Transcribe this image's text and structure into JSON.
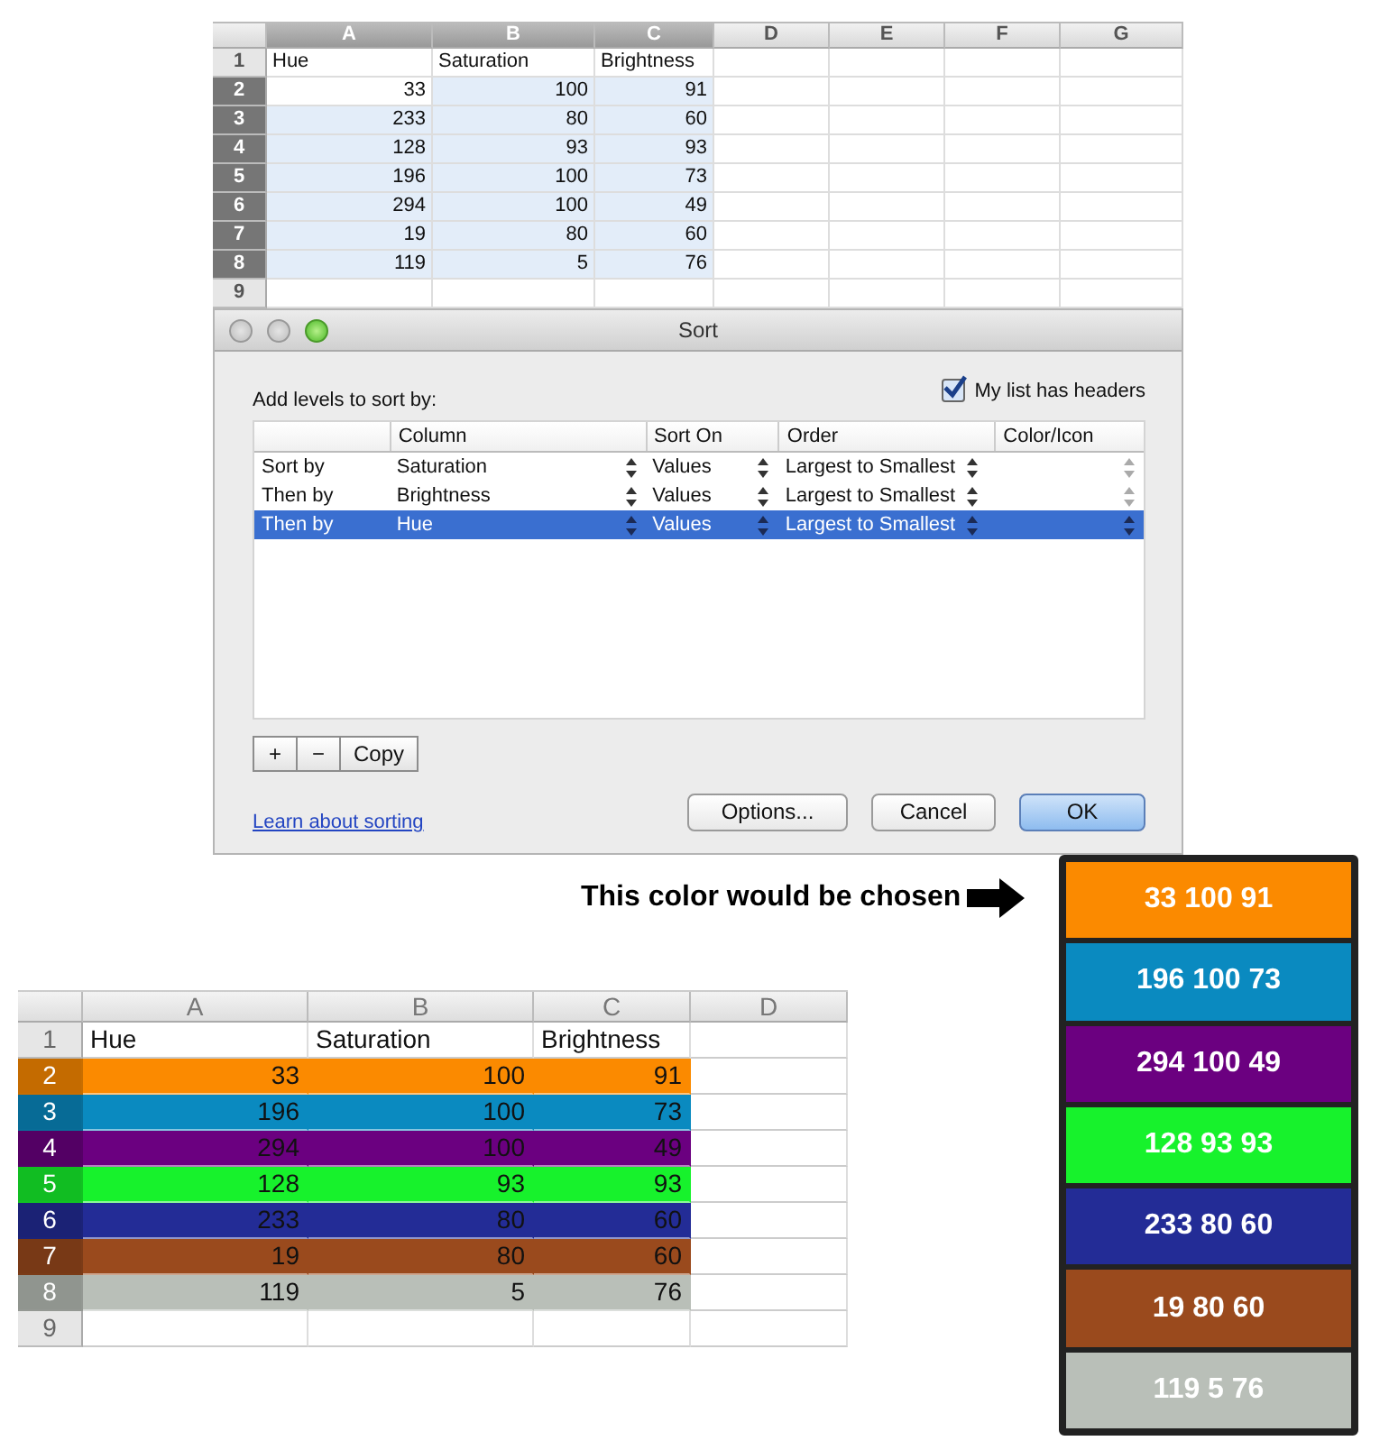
{
  "top_sheet": {
    "columns": [
      {
        "label": "A",
        "selected": true
      },
      {
        "label": "B",
        "selected": true
      },
      {
        "label": "C",
        "selected": true
      },
      {
        "label": "D",
        "selected": false
      },
      {
        "label": "E",
        "selected": false
      },
      {
        "label": "F",
        "selected": false
      },
      {
        "label": "G",
        "selected": false
      }
    ],
    "rows": [
      {
        "number": "1",
        "kind": "header",
        "selected": false,
        "cells": [
          "Hue",
          "Saturation",
          "Brightness"
        ]
      },
      {
        "number": "2",
        "kind": "data",
        "selected": true,
        "cells": [
          "33",
          "100",
          "91"
        ]
      },
      {
        "number": "3",
        "kind": "data",
        "selected": true,
        "cells": [
          "233",
          "80",
          "60"
        ]
      },
      {
        "number": "4",
        "kind": "data",
        "selected": true,
        "cells": [
          "128",
          "93",
          "93"
        ]
      },
      {
        "number": "5",
        "kind": "data",
        "selected": true,
        "cells": [
          "196",
          "100",
          "73"
        ]
      },
      {
        "number": "6",
        "kind": "data",
        "selected": true,
        "cells": [
          "294",
          "100",
          "49"
        ]
      },
      {
        "number": "7",
        "kind": "data",
        "selected": true,
        "cells": [
          "19",
          "80",
          "60"
        ]
      },
      {
        "number": "8",
        "kind": "data",
        "selected": true,
        "cells": [
          "119",
          "5",
          "76"
        ]
      },
      {
        "number": "9",
        "kind": "data",
        "selected": false,
        "cells": []
      }
    ]
  },
  "sort_dialog": {
    "title": "Sort",
    "prompt": "Add levels to sort by:",
    "headers_checkbox": {
      "label": "My list has headers",
      "checked": true
    },
    "columns": [
      "Column",
      "Sort On",
      "Order",
      "Color/Icon"
    ],
    "levels": [
      {
        "label": "Sort by",
        "column": "Saturation",
        "sort_on": "Values",
        "order": "Largest to Smallest",
        "selected": false
      },
      {
        "label": "Then by",
        "column": "Brightness",
        "sort_on": "Values",
        "order": "Largest to Smallest",
        "selected": false
      },
      {
        "label": "Then by",
        "column": "Hue",
        "sort_on": "Values",
        "order": "Largest to Smallest",
        "selected": true
      }
    ],
    "level_buttons": [
      "+",
      "−",
      "Copy"
    ],
    "link": "Learn about sorting",
    "buttons": [
      {
        "label": "Options...",
        "default": false
      },
      {
        "label": "Cancel",
        "default": false
      },
      {
        "label": "OK",
        "default": true
      }
    ]
  },
  "bottom_sheet": {
    "columns": [
      "A",
      "B",
      "C",
      "D"
    ],
    "rows": [
      {
        "number": "1",
        "kind": "header",
        "cells": [
          "Hue",
          "Saturation",
          "Brightness"
        ]
      },
      {
        "number": "2",
        "kind": "data",
        "color": "#fb8a00",
        "cells": [
          "33",
          "100",
          "91"
        ]
      },
      {
        "number": "3",
        "kind": "data",
        "color": "#0a8ac0",
        "cells": [
          "196",
          "100",
          "73"
        ]
      },
      {
        "number": "4",
        "kind": "data",
        "color": "#6b0080",
        "cells": [
          "294",
          "100",
          "49"
        ]
      },
      {
        "number": "5",
        "kind": "data",
        "color": "#17f22c",
        "cells": [
          "128",
          "93",
          "93"
        ]
      },
      {
        "number": "6",
        "kind": "data",
        "color": "#232c96",
        "cells": [
          "233",
          "80",
          "60"
        ]
      },
      {
        "number": "7",
        "kind": "data",
        "color": "#9a4a1d",
        "cells": [
          "19",
          "80",
          "60"
        ]
      },
      {
        "number": "8",
        "kind": "data",
        "color": "#b9bfb8",
        "cells": [
          "119",
          "5",
          "76"
        ]
      },
      {
        "number": "9",
        "kind": "data",
        "cells": []
      }
    ]
  },
  "callout": {
    "label": "This color would be chosen"
  },
  "swatches": [
    {
      "text": "33 100 91",
      "color": "#fb8a00"
    },
    {
      "text": "196 100 73",
      "color": "#0a8ac0"
    },
    {
      "text": "294 100 49",
      "color": "#6b0080"
    },
    {
      "text": "128 93 93",
      "color": "#17f22c"
    },
    {
      "text": "233 80 60",
      "color": "#232c96"
    },
    {
      "text": "19 80 60",
      "color": "#9a4a1d"
    },
    {
      "text": "119 5 76",
      "color": "#b9bfb8"
    }
  ]
}
